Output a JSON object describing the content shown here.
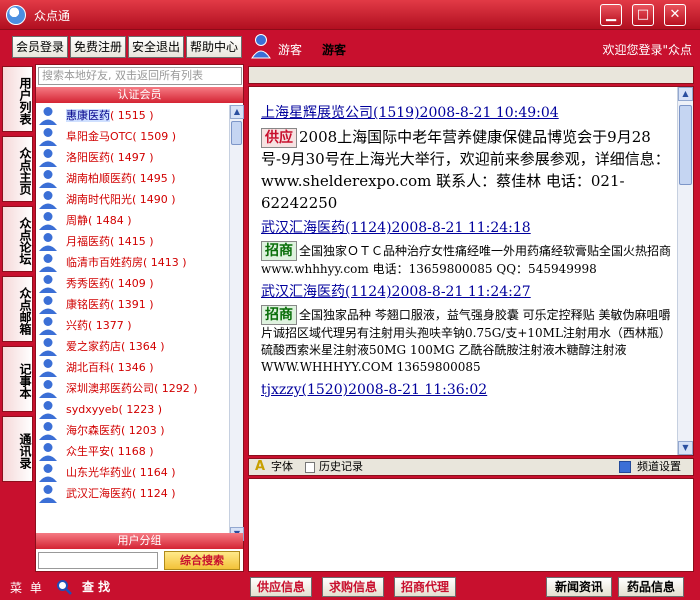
{
  "window": {
    "title": "众点通",
    "min": "▁",
    "max": "□",
    "close": "✕"
  },
  "topbar": {
    "buttons": [
      "会员登录",
      "免费注册",
      "安全退出",
      "帮助中心"
    ],
    "user_label": "游客",
    "user_name": "游客",
    "welcome": "欢迎您登录\"众点"
  },
  "sidetabs": [
    "用户列表",
    "众点主页",
    "众点论坛",
    "众点邮箱",
    "记事本",
    "通讯录"
  ],
  "userpanel": {
    "search_placeholder": "搜索本地好友, 双击返回所有列表",
    "section_certified": "认证会员",
    "section_groups": "用户分组",
    "combo_search": "综合搜索",
    "users": [
      {
        "name": "惠康医药",
        "count": "1515",
        "selected": true
      },
      {
        "name": "阜阳金马OTC",
        "count": "1509"
      },
      {
        "name": "洛阳医药",
        "count": "1497"
      },
      {
        "name": "湖南柏顺医药",
        "count": "1495"
      },
      {
        "name": "湖南时代阳光",
        "count": "1490"
      },
      {
        "name": "周静",
        "count": "1484"
      },
      {
        "name": "月福医药",
        "count": "1415"
      },
      {
        "name": "临清市百姓药房",
        "count": "1413"
      },
      {
        "name": "秀秀医药",
        "count": "1409"
      },
      {
        "name": "康铭医药",
        "count": "1391"
      },
      {
        "name": "兴药",
        "count": "1377"
      },
      {
        "name": "爱之家药店",
        "count": "1364"
      },
      {
        "name": "湖北百科",
        "count": "1346"
      },
      {
        "name": "深圳澳邦医药公司",
        "count": "1292"
      },
      {
        "name": "sydxyyeb",
        "count": "1223"
      },
      {
        "name": "海尔森医药",
        "count": "1203"
      },
      {
        "name": "众生平安",
        "count": "1168"
      },
      {
        "name": "山东光华药业",
        "count": "1164"
      },
      {
        "name": "武汉汇海医药",
        "count": "1124"
      }
    ]
  },
  "content": {
    "messages": [
      {
        "head": "上海星辉展览公司(1519)2008-8-21 10:49:04",
        "badge": "供应",
        "badge_type": "gy",
        "body": "2008上海国际中老年营养健康保健品博览会于9月28号-9月30号在上海光大举行，欢迎前来参展参观，详细信息：www.shelderexpo.com 联系人：蔡佳林 电话：021-62242250"
      },
      {
        "head": "武汉汇海医药(1124)2008-8-21 11:24:18",
        "badge": "招商",
        "badge_type": "zs",
        "body": "全国独家ＯＴＣ品种治疗女性痛经唯一外用药痛经软膏贴全国火热招商 www.whhhyy.com 电话：13659800085 QQ：545949998"
      },
      {
        "head": "武汉汇海医药(1124)2008-8-21 11:24:27",
        "badge": "招商",
        "badge_type": "zs",
        "body": "全国独家品种 芩翘口服液，益气强身胶囊 可乐定控释贴 美敏伪麻咀嚼片诚招区域代理另有注射用头孢呋辛钠0.75G/支+10ML注射用水（西林瓶）硫酸西索米星注射液50MG 100MG 乙酰谷酰胺注射液木糖醇注射液 WWW.WHHHYY.COM 13659800085"
      },
      {
        "head": "tjxzzy(1520)2008-8-21 11:36:02",
        "badge": "",
        "badge_type": "",
        "body": ""
      }
    ]
  },
  "fontbar": {
    "font": "字体",
    "history": "历史记录",
    "channel": "频道设置"
  },
  "bottombar": {
    "menu": "菜 单",
    "find": "查 找",
    "tabs": [
      "供应信息",
      "求购信息",
      "招商代理"
    ],
    "right_tabs": [
      "新闻资讯",
      "药品信息"
    ]
  },
  "colors": {
    "brand_red": "#c8102e",
    "link_blue": "#00009c"
  }
}
